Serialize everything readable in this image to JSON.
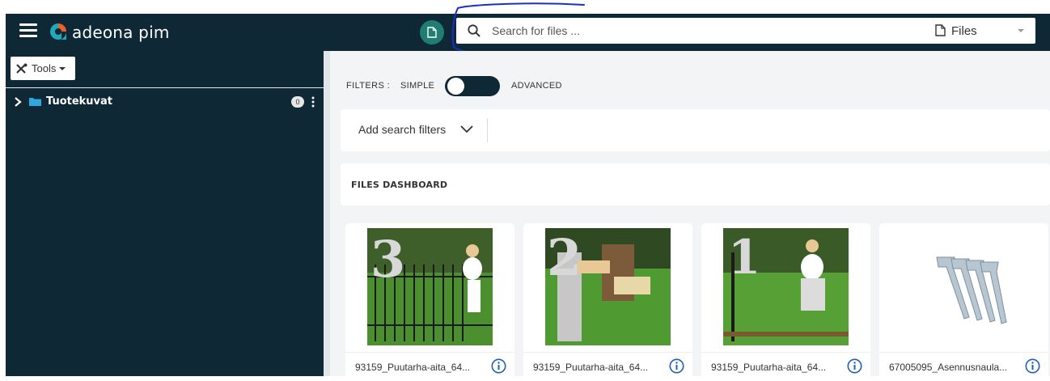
{
  "header": {
    "brand": "adeona pim",
    "search_placeholder": "Search for files ...",
    "files_select_label": "Files"
  },
  "sidebar": {
    "tools_label": "Tools",
    "tree": [
      {
        "label": "Tuotekuvat",
        "count": "0"
      }
    ]
  },
  "filters": {
    "label": "FILTERS :",
    "simple": "SIMPLE",
    "advanced": "ADVANCED",
    "mode": "simple",
    "add_search_filters": "Add search filters"
  },
  "dashboard": {
    "title": "FILES DASHBOARD",
    "files": [
      {
        "name": "93159_Puutarha-aita_64...",
        "badge": "3"
      },
      {
        "name": "93159_Puutarha-aita_64...",
        "badge": "2"
      },
      {
        "name": "93159_Puutarha-aita_64...",
        "badge": "1"
      },
      {
        "name": "67005095_Asennusnaula..."
      }
    ]
  },
  "colors": {
    "navy": "#0e2836",
    "teal": "#1f7d74",
    "info_blue": "#1f5fb4",
    "annotation_blue": "#1a2fc7"
  }
}
